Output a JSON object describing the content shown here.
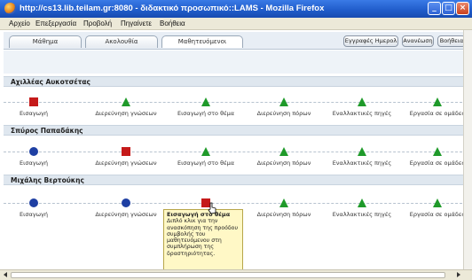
{
  "window": {
    "title": "http://cs13.lib.teilam.gr:8080 - διδακτικό προσωπικό::LAMS - Mozilla Firefox"
  },
  "menu": [
    "Αρχείο",
    "Επεξεργασία",
    "Προβολή",
    "Πηγαίνετε",
    "Βοήθεια"
  ],
  "tabs": [
    "Μάθημα",
    "Ακολουθία",
    "Μαθητευόμενοι"
  ],
  "toolbar_buttons": [
    "Εγγραφές Ημερολ",
    "Ανανέωση",
    "Βοήθεια"
  ],
  "activities": [
    "Εισαγωγή",
    "Διερεύνηση γνώσεων",
    "Εισαγωγή στο θέμα",
    "Διερεύνηση πόρων",
    "Εναλλακτικές πηγές",
    "Εργασία σε ομάδες"
  ],
  "students": [
    {
      "name": "Αχιλλέας Αυκοτσέτας",
      "states": [
        "square",
        "triangle",
        "triangle",
        "triangle",
        "triangle",
        "triangle"
      ]
    },
    {
      "name": "Σπύρος Παπαδάκης",
      "states": [
        "circle",
        "square",
        "triangle",
        "triangle",
        "triangle",
        "triangle"
      ]
    },
    {
      "name": "Μιχάλης Βερτούκης",
      "states": [
        "circle",
        "circle",
        "square",
        "triangle",
        "triangle",
        "triangle"
      ]
    }
  ],
  "tooltip": {
    "title": "Εισαγωγή στο θέμα",
    "body": "Διπλό κλικ για την ανασκόπηση της προόδου συμβολής του μαθητευόμενου στη συμπλήρωση της δραστηριότητας."
  },
  "colors": {
    "completed": "#1e3fa3",
    "current": "#c51a1a",
    "not_started": "#1f9a2a"
  }
}
